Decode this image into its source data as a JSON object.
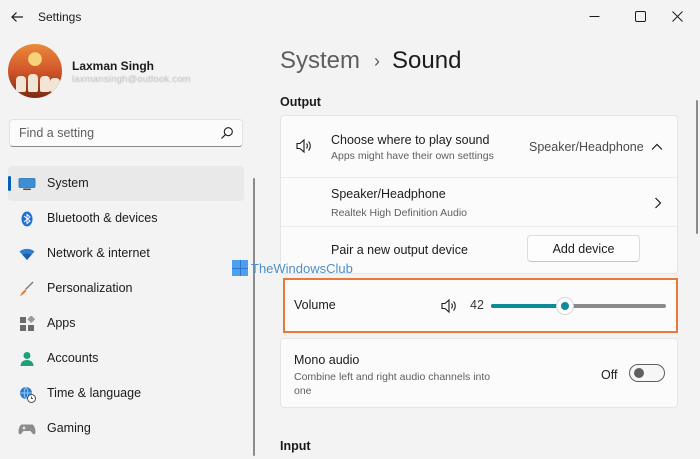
{
  "window": {
    "title": "Settings",
    "back_icon": "back-arrow-icon",
    "minimize_icon": "minimize-icon",
    "maximize_icon": "maximize-icon",
    "close_icon": "close-icon"
  },
  "user": {
    "name": "Laxman Singh",
    "email": "laxmansingh@outlook.com"
  },
  "search": {
    "placeholder": "Find a setting",
    "icon": "search-icon"
  },
  "sidebar": {
    "accent": "#005fb8",
    "selected": "System",
    "items": [
      {
        "label": "System",
        "icon": "monitor-icon"
      },
      {
        "label": "Bluetooth & devices",
        "icon": "bluetooth-icon"
      },
      {
        "label": "Network & internet",
        "icon": "wifi-icon"
      },
      {
        "label": "Personalization",
        "icon": "brush-icon"
      },
      {
        "label": "Apps",
        "icon": "apps-icon"
      },
      {
        "label": "Accounts",
        "icon": "person-icon"
      },
      {
        "label": "Time & language",
        "icon": "globe-clock-icon"
      },
      {
        "label": "Gaming",
        "icon": "controller-icon"
      }
    ]
  },
  "breadcrumb": {
    "parent": "System",
    "separator": "›",
    "current": "Sound"
  },
  "output": {
    "section_title": "Output",
    "choose": {
      "title": "Choose where to play sound",
      "subtitle": "Apps might have their own settings",
      "value": "Speaker/Headphone",
      "icon": "speaker-icon",
      "expanded": true
    },
    "device": {
      "name": "Speaker/Headphone",
      "detail": "Realtek High Definition Audio"
    },
    "pair": {
      "label": "Pair a new output device",
      "button": "Add device"
    },
    "volume": {
      "label": "Volume",
      "value": "42",
      "level_percent": 42,
      "icon": "speaker-icon",
      "highlight_color": "#e8793a",
      "accent": "#0f8a9a"
    },
    "mono": {
      "title": "Mono audio",
      "description_line1": "Combine left and right audio channels into",
      "description_line2": "one",
      "state": "Off"
    }
  },
  "input": {
    "section_title": "Input"
  },
  "watermark": {
    "text": "TheWindowsClub"
  }
}
